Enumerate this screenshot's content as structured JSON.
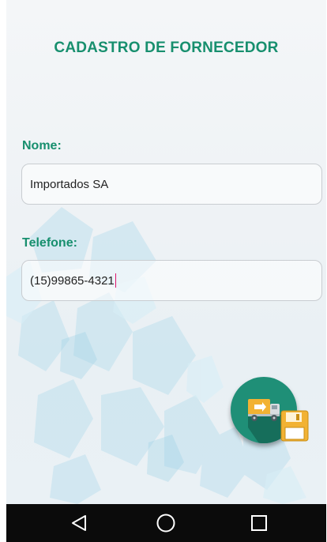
{
  "screen": {
    "title": "CADASTRO DE FORNECEDOR"
  },
  "form": {
    "name_label": "Nome:",
    "name_value": "Importados SA",
    "phone_label": "Telefone:",
    "phone_value": "(15)99865-4321"
  },
  "fab": {
    "icon": "truck-save-icon"
  },
  "navbar": {
    "back_icon": "back-triangle-icon",
    "home_icon": "home-circle-icon",
    "recents_icon": "recents-square-icon"
  },
  "colors": {
    "accent": "#178f6e",
    "fab": "#1f8f77",
    "cursor": "#e0156b",
    "navbar": "#0b0b0b"
  }
}
